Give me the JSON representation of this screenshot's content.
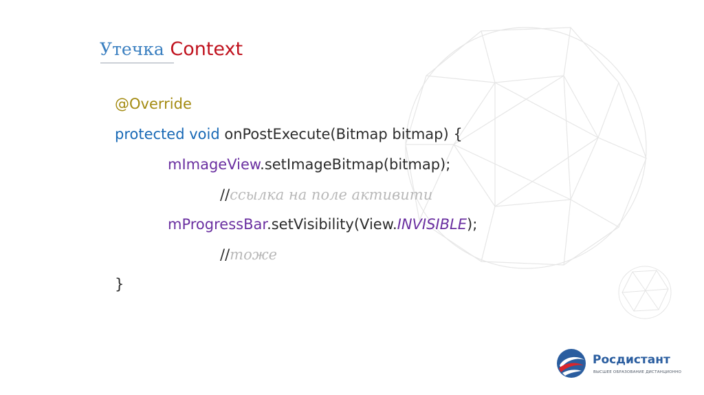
{
  "title": {
    "word_ru": "Утечка",
    "word_en": "Context"
  },
  "code": {
    "annotation": "@Override",
    "signature_keywords": "protected void",
    "signature_rest": "onPostExecute(Bitmap bitmap) {",
    "line3_field": "mImageView",
    "line3_rest": ".setImageBitmap(bitmap);",
    "comment1_slashes": "//",
    "comment1_text": "ссылка на поле активити",
    "line5_field": "mProgressBar",
    "line5_mid": ".setVisibility(View.",
    "line5_const": "INVISIBLE",
    "line5_end": ");",
    "comment2_slashes": "//",
    "comment2_text": "тоже",
    "closing_brace": "}"
  },
  "logo": {
    "name": "Росдистант",
    "tagline": "ВЫСШЕЕ ОБРАЗОВАНИЕ ДИСТАНЦИОННО",
    "icon": "globe-swirl-icon",
    "colors": {
      "primary": "#2a5d9f",
      "accent": "#d9262c"
    }
  },
  "colors": {
    "title_ru": "#3a7fc0",
    "title_en": "#c0121e",
    "annotation": "#a38a10",
    "keyword": "#1768b5",
    "field": "#6a2fa0",
    "comment": "#b8b8b8"
  }
}
